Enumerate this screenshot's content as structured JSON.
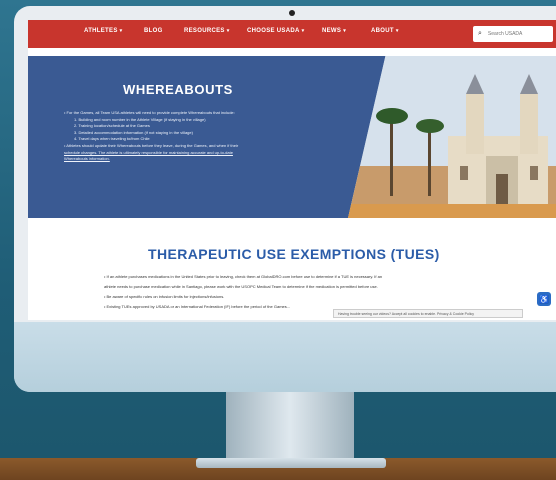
{
  "nav": {
    "items": [
      {
        "label": "ATHLETES",
        "has_menu": true
      },
      {
        "label": "BLOG",
        "has_menu": false
      },
      {
        "label": "RESOURCES",
        "has_menu": true
      },
      {
        "label": "CHOOSE USADA",
        "has_menu": true
      },
      {
        "label": "NEWS",
        "has_menu": true
      },
      {
        "label": "ABOUT",
        "has_menu": true
      }
    ],
    "search_placeholder": "Search USADA",
    "search_icon": "search-icon",
    "background_color": "#c8352d"
  },
  "hero": {
    "title": "WHEREABOUTS",
    "lines": [
      "• For the Games, all Team USA athletes will need to provide complete Whereabouts that include:",
      "1. Building and room number in the Athlete Village (if staying in the village)",
      "2. Training location/schedule at the Games",
      "3. Detailed accommodation information (if not staying in the village)",
      "4. Travel days when traveling to/from Chile",
      "• Athletes should update their Whereabouts before they leave, during the Games, and when if their",
      "  schedule changes. The athlete is ultimately responsible for maintaining accurate and up-to-date",
      "  Whereabouts information."
    ],
    "panel_color": "#3a5a93",
    "image_subject": "cathedral-photo"
  },
  "tues": {
    "title": "THERAPEUTIC USE EXEMPTIONS (TUES)",
    "lines": [
      "• If an athlete purchases medications in the United States prior to leaving, check them at GlobalDRO.com before use to determine if a TUE is necessary. If an",
      "  athlete needs to purchase medication while in Santiago, please work with the USOPC Medical Team to determine if the medication is permitted before use.",
      "• Be aware of specific rules on infusion limits for injections/infusions.",
      "• Existing TUEs approved by USADA or an International Federation (IF) before the period of the Games..."
    ],
    "title_color": "#2b5ca8"
  },
  "cookie_banner": {
    "text": "Having trouble seeing our videos? Accept all cookies to enable. Privacy & Cookie Policy"
  },
  "accessibility_button": {
    "icon": "accessibility-icon",
    "color": "#2b6cc4"
  }
}
